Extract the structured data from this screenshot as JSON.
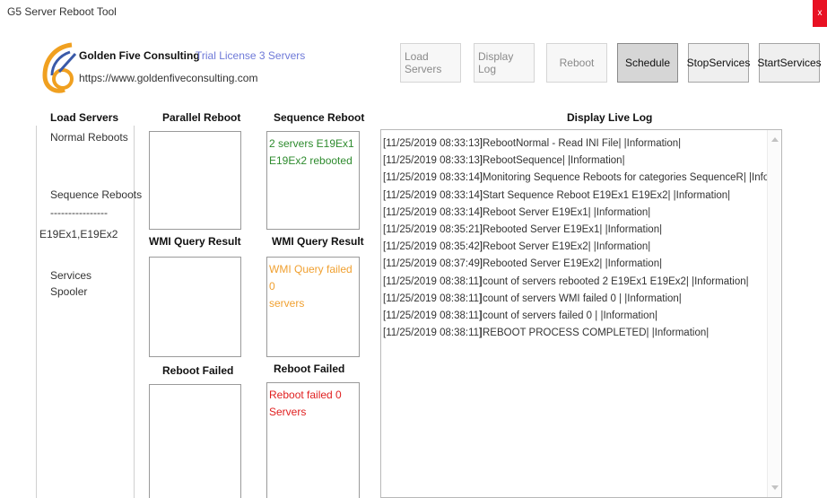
{
  "window": {
    "title": "G5 Server Reboot Tool",
    "close_label": "x"
  },
  "brand": {
    "name": "Golden Five Consulting",
    "license": "Trial License 3 Servers",
    "url": "https://www.goldenfiveconsulting.com",
    "colors": {
      "accent": "#f0a020",
      "blue": "#3a5aa8"
    }
  },
  "toolbar": {
    "load_servers": "Load Servers",
    "display_log": "Display Log",
    "reboot": "Reboot",
    "schedule": "Schedule",
    "stop_services": "StopServices",
    "start_services": "StartServices"
  },
  "load_servers": {
    "header": "Load Servers",
    "normal": "Normal Reboots",
    "sequence": "Sequence Reboots",
    "separator": "----------------",
    "servers": "E19Ex1,E19Ex2",
    "services": "Services",
    "spooler": "Spooler"
  },
  "parallel": {
    "header": "Parallel Reboot",
    "wmi_header": "WMI Query Result",
    "failed_header": "Reboot Failed"
  },
  "sequence": {
    "header": "Sequence Reboot",
    "reboot_line1": "2 servers E19Ex1",
    "reboot_line2": "E19Ex2 rebooted",
    "wmi_header": "WMI Query Result",
    "wmi_line1": "WMI Query failed 0",
    "wmi_line2": "servers",
    "failed_header": "Reboot Failed",
    "failed_line1": "Reboot failed 0",
    "failed_line2": "Servers"
  },
  "log": {
    "header": "Display Live Log",
    "lines": [
      {
        "ts": "[11/25/2019 08:33:13]",
        "msg": "|RebootNormal - Read INI File| |Information|"
      },
      {
        "ts": "[11/25/2019 08:33:13]",
        "msg": "|RebootSequence| |Information|"
      },
      {
        "ts": "[11/25/2019 08:33:14]",
        "msg": "|Monitoring Sequence Reboots for categories SequenceR| |Information|"
      },
      {
        "ts": "[11/25/2019 08:33:14]",
        "msg": "|Start Sequence Reboot E19Ex1 E19Ex2| |Information|"
      },
      {
        "ts": "[11/25/2019 08:33:14]",
        "msg": "|Reboot Server E19Ex1| |Information|"
      },
      {
        "ts": "[11/25/2019 08:35:21]",
        "msg": "|Rebooted Server E19Ex1| |Information|"
      },
      {
        "ts": "[11/25/2019 08:35:42]",
        "msg": "|Reboot Server E19Ex2| |Information|"
      },
      {
        "ts": "[11/25/2019 08:37:49]",
        "msg": "|Rebooted Server E19Ex2| |Information|"
      },
      {
        "ts": "[11/25/2019 08:38:11]",
        "msg": "|count of servers rebooted 2 E19Ex1 E19Ex2| |Information|"
      },
      {
        "ts": "[11/25/2019 08:38:11]",
        "msg": "|count of servers WMI failed 0 | |Information|"
      },
      {
        "ts": "[11/25/2019 08:38:11]",
        "msg": "|count of servers failed 0 | |Information|"
      },
      {
        "ts": "[11/25/2019 08:38:11]",
        "msg": "|REBOOT PROCESS COMPLETED| |Information|"
      }
    ]
  }
}
